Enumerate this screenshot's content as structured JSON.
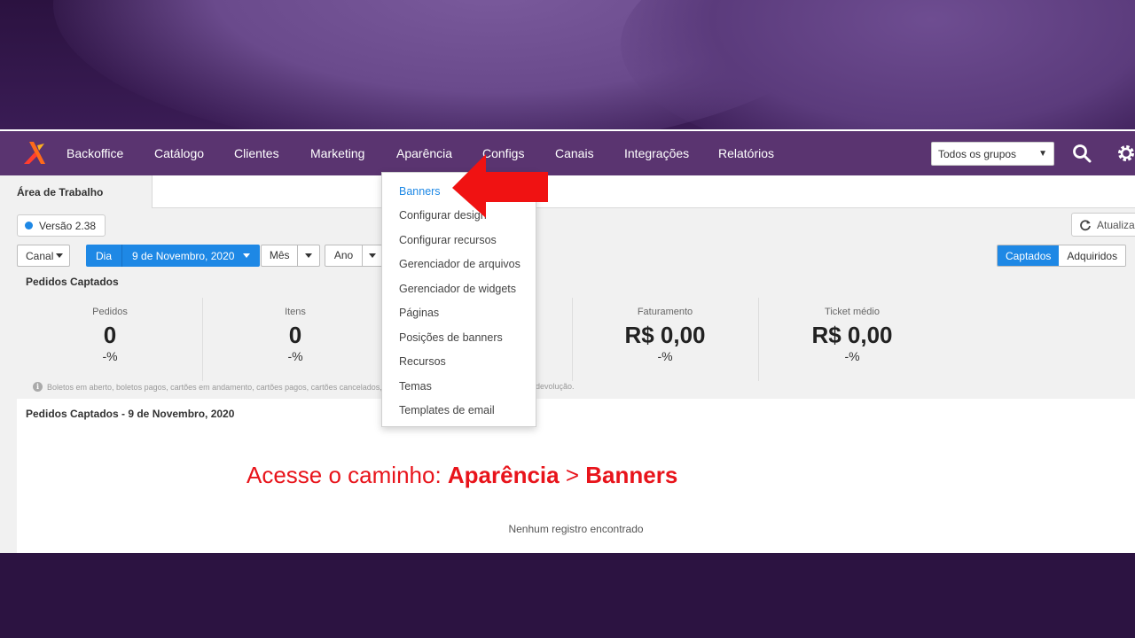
{
  "nav": {
    "items": [
      "Backoffice",
      "Catálogo",
      "Clientes",
      "Marketing",
      "Aparência",
      "Configs",
      "Canais",
      "Integrações",
      "Relatórios"
    ],
    "group_select": "Todos os grupos"
  },
  "tabs": {
    "active": "Área de Trabalho"
  },
  "version": "Versão 2.38",
  "refresh_label": "Atualizar",
  "filters": {
    "canal": "Canal",
    "dia": "Dia",
    "date": "9 de Novembro, 2020",
    "mes": "Mês",
    "ano": "Ano",
    "captados": "Captados",
    "adquiridos": "Adquiridos"
  },
  "summary": {
    "title": "Pedidos Captados",
    "metrics": [
      {
        "label": "Pedidos",
        "value": "0",
        "pct": "-%"
      },
      {
        "label": "Itens",
        "value": "0",
        "pct": "-%"
      },
      {
        "label": "Faturamento",
        "value": "R$ 0,00",
        "pct": "-%"
      },
      {
        "label": "Ticket médio",
        "value": "R$ 0,00",
        "pct": "-%"
      }
    ],
    "note_left": "Boletos em aberto, boletos pagos, cartões em andamento, cartões pagos, cartões cancelados, bo",
    "note_right": "o, devolução."
  },
  "orders_panel": {
    "title": "Pedidos Captados - 9 de Novembro, 2020",
    "empty": "Nenhum registro encontrado"
  },
  "dropdown": {
    "items": [
      "Banners",
      "Configurar design",
      "Configurar recursos",
      "Gerenciador de arquivos",
      "Gerenciador de widgets",
      "Páginas",
      "Posições de banners",
      "Recursos",
      "Temas",
      "Templates de email"
    ]
  },
  "caption": {
    "prefix": "Acesse o caminho: ",
    "step1": "Aparência",
    "sep": " > ",
    "step2": "Banners"
  },
  "colors": {
    "nav_bg": "#5a3470",
    "accent": "#1e88e5",
    "annotation": "#e8141b"
  }
}
